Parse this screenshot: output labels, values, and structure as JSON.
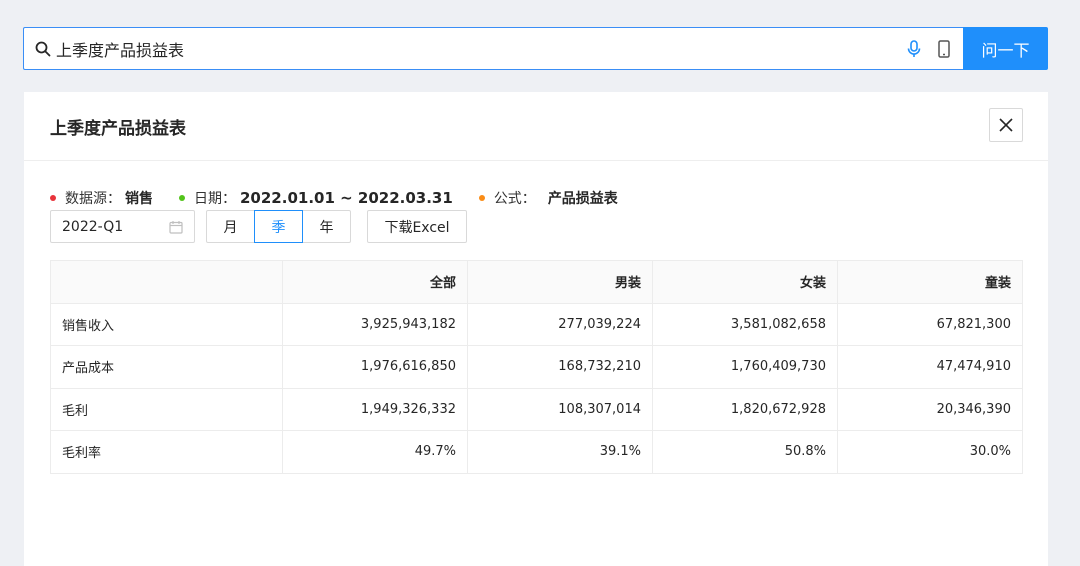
{
  "search": {
    "value": "上季度产品损益表",
    "button_label": "问一下"
  },
  "panel": {
    "title": "上季度产品损益表",
    "meta": {
      "source_label": "数据源：",
      "source_value": "销售",
      "date_label": "日期：",
      "date_value": "2022.01.01 ~ 2022.03.31",
      "formula_label": "公式：",
      "formula_value": "产品损益表"
    },
    "controls": {
      "date_value": "2022-Q1",
      "periods": [
        "月",
        "季",
        "年"
      ],
      "active_period": "季",
      "download_label": "下载Excel"
    },
    "table": {
      "headers": [
        "",
        "全部",
        "男装",
        "女装",
        "童装"
      ],
      "rows": [
        [
          "销售收入",
          "3,925,943,182",
          "277,039,224",
          "3,581,082,658",
          "67,821,300"
        ],
        [
          "产品成本",
          "1,976,616,850",
          "168,732,210",
          "1,760,409,730",
          "47,474,910"
        ],
        [
          "毛利",
          "1,949,326,332",
          "108,307,014",
          "1,820,672,928",
          "20,346,390"
        ],
        [
          "毛利率",
          "49.7%",
          "39.1%",
          "50.8%",
          "30.0%"
        ]
      ]
    }
  },
  "colors": {
    "accent": "#1f8ffb",
    "dot_source": "#e8333a",
    "dot_date": "#52c41a",
    "dot_formula": "#fa8c16"
  }
}
